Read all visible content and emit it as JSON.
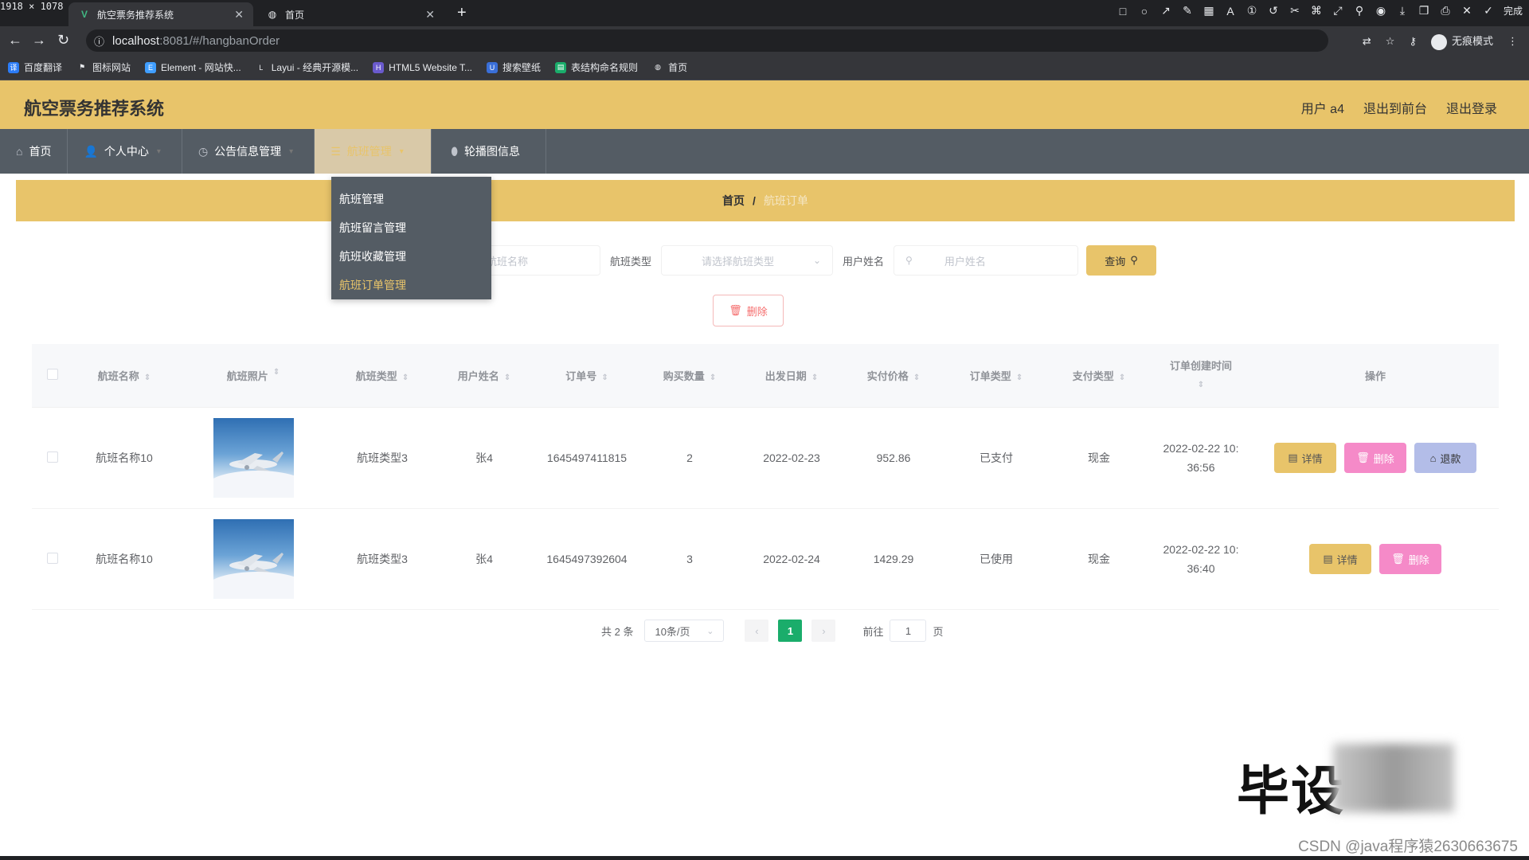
{
  "browser": {
    "dims": "1918 × 1078",
    "tabs": [
      {
        "title": "航空票务推荐系统",
        "active": true
      },
      {
        "title": "首页",
        "active": false
      }
    ],
    "url_host": "localhost",
    "url_rest": ":8081/#/hangbanOrder",
    "incognito_label": "无痕模式",
    "done_label": "完成",
    "bookmarks": [
      "百度翻译",
      "图标网站",
      "Element - 网站快...",
      "Layui - 经典开源模...",
      "HTML5 Website T...",
      "搜索壁纸",
      "表结构命名规则",
      "首页"
    ]
  },
  "header": {
    "title": "航空票务推荐系统",
    "user": "用户 a4",
    "to_front": "退出到前台",
    "logout": "退出登录"
  },
  "menu": [
    {
      "label": "首页",
      "icon": "home-icon"
    },
    {
      "label": "个人中心",
      "icon": "user-icon"
    },
    {
      "label": "公告信息管理",
      "icon": "clock-icon"
    },
    {
      "label": "航班管理",
      "icon": "list-icon"
    },
    {
      "label": "轮播图信息",
      "icon": "location-icon"
    }
  ],
  "submenu": [
    "航班管理",
    "航班留言管理",
    "航班收藏管理",
    "航班订单管理"
  ],
  "breadcrumb": {
    "home": "首页",
    "sep": "/",
    "current": "航班订单"
  },
  "search": {
    "name_placeholder": "航班名称",
    "type_label": "航班类型",
    "type_placeholder": "请选择航班类型",
    "user_label": "用户姓名",
    "user_placeholder": "用户姓名",
    "query": "查询"
  },
  "actions": {
    "delete": "删除"
  },
  "table": {
    "headers": [
      "航班名称",
      "航班照片",
      "航班类型",
      "用户姓名",
      "订单号",
      "购买数量",
      "出发日期",
      "实付价格",
      "订单类型",
      "支付类型",
      "订单创建时间",
      "操作"
    ],
    "rows": [
      {
        "name": "航班名称10",
        "type": "航班类型3",
        "user": "张4",
        "order": "1645497411815",
        "qty": "2",
        "date": "2022-02-23",
        "price": "952.86",
        "otype": "已支付",
        "pay": "现金",
        "time1": "2022-02-22 10:",
        "time2": "36:56"
      },
      {
        "name": "航班名称10",
        "type": "航班类型3",
        "user": "张4",
        "order": "1645497392604",
        "qty": "3",
        "date": "2022-02-24",
        "price": "1429.29",
        "otype": "已使用",
        "pay": "现金",
        "time1": "2022-02-22 10:",
        "time2": "36:40"
      }
    ],
    "ops": {
      "detail": "详情",
      "delete": "删除",
      "refund": "退款"
    }
  },
  "pagination": {
    "total": "共 2 条",
    "size": "10条/页",
    "page": "1",
    "goto": "前往",
    "goto_value": "1",
    "goto_unit": "页"
  },
  "watermark": {
    "text": "毕设",
    "credit": "CSDN @java程序猿2630663675"
  },
  "colors": {
    "accent": "#e8c46a",
    "menu_bg": "#545c64",
    "page_active": "#1aad6b",
    "delete": "#f58ac8",
    "refund": "#b3bde8"
  }
}
